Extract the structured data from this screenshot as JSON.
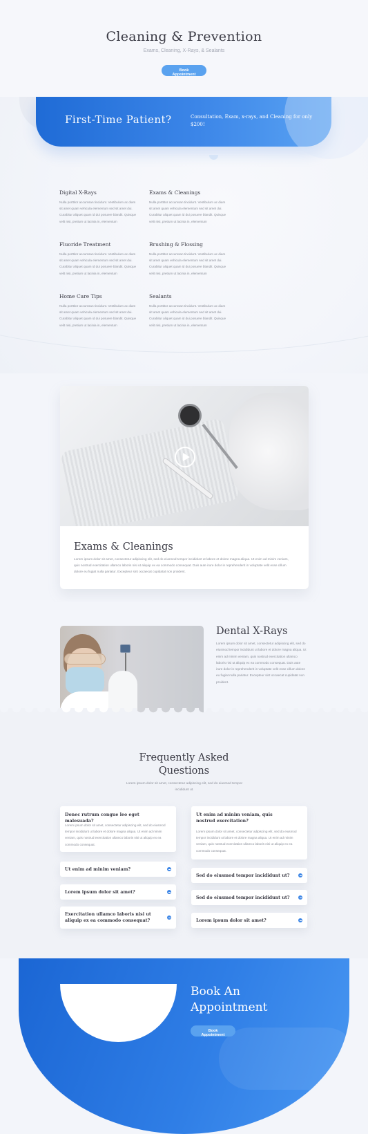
{
  "hero": {
    "title": "Cleaning & Prevention",
    "subtitle": "Exams, Cleaning, X-Rays, & Sealants",
    "button": "Book Appointment"
  },
  "first_time": {
    "title": "First-Time Patient?",
    "description": "Consultation, Exam, x-rays, and Cleaning for only $200!"
  },
  "services": [
    {
      "title": "Digital X-Rays",
      "text": "Nulla porttitor accumsan tincidunt. Vestibulum ac diam sit amet quam vehicula elementum sed sit amet dui. Curabitur aliquet quam id dui posuere blandit. Quisque velit nisi, pretium ut lacinia in, elementum"
    },
    {
      "title": "Exams & Cleanings",
      "text": "Nulla porttitor accumsan tincidunt. Vestibulum ac diam sit amet quam vehicula elementum sed sit amet dui. Curabitur aliquet quam id dui posuere blandit. Quisque velit nisi, pretium ut lacinia in, elementum"
    },
    {
      "title": "Fluoride Treatment",
      "text": "Nulla porttitor accumsan tincidunt. Vestibulum ac diam sit amet quam vehicula elementum sed sit amet dui. Curabitur aliquet quam id dui posuere blandit. Quisque velit nisi, pretium ut lacinia in, elementum"
    },
    {
      "title": "Brushing & Flossing",
      "text": "Nulla porttitor accumsan tincidunt. Vestibulum ac diam sit amet quam vehicula elementum sed sit amet dui. Curabitur aliquet quam id dui posuere blandit. Quisque velit nisi, pretium ut lacinia in, elementum"
    },
    {
      "title": "Home Care Tips",
      "text": "Nulla porttitor accumsan tincidunt. Vestibulum ac diam sit amet quam vehicula elementum sed sit amet dui. Curabitur aliquet quam id dui posuere blandit. Quisque velit nisi, pretium ut lacinia in, elementum"
    },
    {
      "title": "Sealants",
      "text": "Nulla porttitor accumsan tincidunt. Vestibulum ac diam sit amet quam vehicula elementum sed sit amet dui. Curabitur aliquet quam id dui posuere blandit. Quisque velit nisi, pretium ut lacinia in, elementum"
    }
  ],
  "video_card": {
    "title": "Exams & Cleanings",
    "text": "Lorem ipsum dolor sit amet, consectetur adipiscing elit, sed do eiusmod tempor incididunt ut labore et dolore magna aliqua. Ut enim ad minim veniam, quis nostrud exercitation ullamco laboris nisi ut aliquip ex ea commodo consequat. Duis aute irure dolor in reprehenderit in voluptate velit esse cillum dolore eu fugiat nulla pariatur. Excepteur sint occaecat cupidatat non proident."
  },
  "xray": {
    "title": "Dental X-Rays",
    "text": "Lorem ipsum dolor sit amet, consectetur adipiscing elit, sed do eiusmod tempor incididunt ut labore et dolore magna aliqua. Ut enim ad minim veniam, quis nostrud exercitation ullamco laboris nisi ut aliquip ex ea commodo consequat. Duis aute irure dolor in reprehenderit in voluptate velit esse cillum dolore eu fugiat nulla pariatur. Excepteur sint occaecat cupidatat non proident."
  },
  "faq": {
    "title_line1": "Frequently Asked",
    "title_line2": "Questions",
    "intro": "Lorem ipsum dolor sit amet, consectetur adipiscing elit, sed do eiusmod tempor incididunt ut.",
    "left": [
      {
        "q": "Donec rutrum congue leo eget malesuada?",
        "a": "Lorem ipsum dolor sit amet, consectetur adipiscing elit, sed do eiusmod tempor incididunt ut labore et dolore magna aliqua. Ut enim ad minim veniam, quis nostrud exercitation ullamco laboris nisi ut aliquip ex ea commodo consequat."
      },
      {
        "q": "Ut enim ad minim veniam?"
      },
      {
        "q": "Lorem ipsum dolor sit amet?"
      },
      {
        "q": "Exercitation ullamco laboris nisi ut aliquip ex ea commodo consequat?"
      }
    ],
    "right": [
      {
        "q": "Ut enim ad minim veniam, quis nostrud exercitation?",
        "a": "Lorem ipsum dolor sit amet, consectetur adipiscing elit, sed do eiusmod tempor incididunt ut labore et dolore magna aliqua. Ut enim ad minim veniam, quis nostrud exercitation ullamco laboris nisi ut aliquip ex ea commodo consequat."
      },
      {
        "q": "Sed do eiusmod tempor incididunt ut?"
      },
      {
        "q": "Sed do eiusmod tempor incididunt ut?"
      },
      {
        "q": "Lorem ipsum dolor sit amet?"
      }
    ]
  },
  "booking": {
    "title_line1": "Book An",
    "title_line2": "Appointment",
    "button": "Book Appointment"
  },
  "colors": {
    "accent": "#3d86e6",
    "button": "#5aa2ef",
    "heading": "#3a3a44"
  },
  "icons": {
    "play": "play-icon",
    "toggle": "plus-minus-icon"
  }
}
